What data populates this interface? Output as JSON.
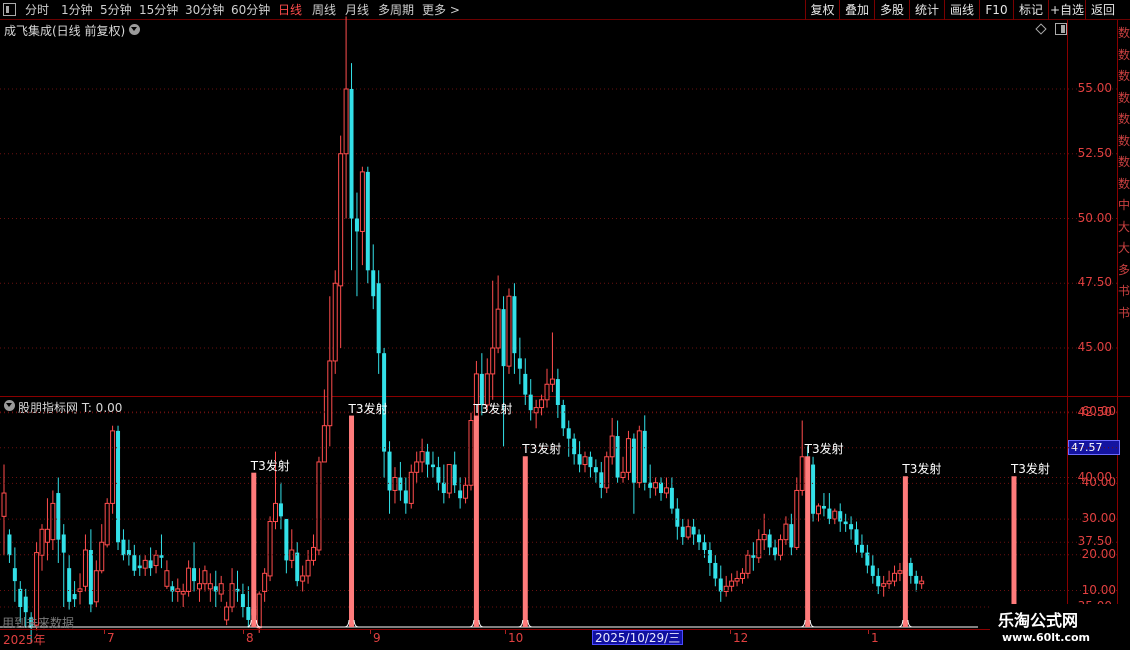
{
  "toolbar": {
    "periods": [
      "分时",
      "1分钟",
      "5分钟",
      "15分钟",
      "30分钟",
      "60分钟",
      "日线",
      "周线",
      "月线",
      "多周期",
      "更多 >"
    ],
    "active_period": "日线",
    "tools": [
      "复权",
      "叠加",
      "多股",
      "统计",
      "画线",
      "F10",
      "标记",
      "+自选",
      "返回"
    ]
  },
  "main_panel": {
    "title": "成飞集成(日线 前复权)",
    "price_ticks": [
      "55.00",
      "52.50",
      "50.00",
      "47.50",
      "45.00",
      "42.50",
      "40.00",
      "37.50",
      "35.00"
    ]
  },
  "indicator_panel": {
    "title": "股朋指标网  T: 0.00",
    "ticks": [
      "60.00",
      "50.00",
      "40.00",
      "30.00",
      "20.00",
      "10.00"
    ],
    "highlight_value": "47.57",
    "signal_text": "T3发射",
    "future_note": "用到未来数据"
  },
  "date_axis": {
    "labels": [
      "2025年",
      "7",
      "8",
      "9",
      "10",
      "11",
      "12",
      "1"
    ],
    "cursor": "2025/10/29/三"
  },
  "right_strip_chars": [
    "数",
    "数",
    "数",
    "数",
    "数",
    "数",
    "数",
    "数",
    "中",
    "大",
    "大",
    "多",
    "书",
    "书"
  ],
  "watermark": {
    "title": "乐淘公式网",
    "url": "www.60lt.com"
  },
  "colors": {
    "up": "#ff4d4d",
    "down": "#33e0e8",
    "signal": "#ff7b7b",
    "axis": "#e04040"
  },
  "chart_data": {
    "type": "candlestick",
    "ylim": [
      33,
      58
    ],
    "candles": [
      [
        38.5,
        40.5,
        39.4,
        37.0
      ],
      [
        37.8,
        38.0,
        37.0,
        36.7
      ],
      [
        36.5,
        37.3,
        36.0,
        35.2
      ],
      [
        35.7,
        36.0,
        35.0,
        34.4
      ],
      [
        35.4,
        35.7,
        34.8,
        34.2
      ],
      [
        34.6,
        34.8,
        34.2,
        33.6
      ],
      [
        34.3,
        37.5,
        37.1,
        34.1
      ],
      [
        37.0,
        38.2,
        38.0,
        36.4
      ],
      [
        37.5,
        39.2,
        38.0,
        36.8
      ],
      [
        37.6,
        39.5,
        39.0,
        37.2
      ],
      [
        39.4,
        40.0,
        37.6,
        36.7
      ],
      [
        37.8,
        38.2,
        37.1,
        35.0
      ],
      [
        36.5,
        37.0,
        35.2,
        34.9
      ],
      [
        35.5,
        36.0,
        35.3,
        35.0
      ],
      [
        35.6,
        36.3,
        35.7,
        35.1
      ],
      [
        35.8,
        37.8,
        37.2,
        35.6
      ],
      [
        37.2,
        38.0,
        35.1,
        34.8
      ],
      [
        35.2,
        36.8,
        36.4,
        35.0
      ],
      [
        36.4,
        38.2,
        37.5,
        36.3
      ],
      [
        37.4,
        39.2,
        39.0,
        37.3
      ],
      [
        39.0,
        42.0,
        41.8,
        38.6
      ],
      [
        41.8,
        42.0,
        37.5,
        37.2
      ],
      [
        37.6,
        38.0,
        37.0,
        36.8
      ],
      [
        37.2,
        37.6,
        37.0,
        36.6
      ],
      [
        37.0,
        37.4,
        36.4,
        36.2
      ],
      [
        36.6,
        37.0,
        36.5,
        36.2
      ],
      [
        36.5,
        37.0,
        36.8,
        36.2
      ],
      [
        36.8,
        37.3,
        36.5,
        36.2
      ],
      [
        36.6,
        37.2,
        37.0,
        36.3
      ],
      [
        37.0,
        37.8,
        36.9,
        36.5
      ],
      [
        35.8,
        36.8,
        36.4,
        35.7
      ],
      [
        35.8,
        36.0,
        35.6,
        35.2
      ],
      [
        35.6,
        36.1,
        35.7,
        35.2
      ],
      [
        35.5,
        35.9,
        35.6,
        35.0
      ],
      [
        35.6,
        36.8,
        36.5,
        35.4
      ],
      [
        36.5,
        37.5,
        36.0,
        35.6
      ],
      [
        35.7,
        36.5,
        35.9,
        35.2
      ],
      [
        35.9,
        36.6,
        36.4,
        35.6
      ],
      [
        35.7,
        36.3,
        35.9,
        35.2
      ],
      [
        35.8,
        36.4,
        35.6,
        35.0
      ],
      [
        35.5,
        36.2,
        35.9,
        35.2
      ],
      [
        34.5,
        35.2,
        35.0,
        34.3
      ],
      [
        35.0,
        36.5,
        35.9,
        34.8
      ],
      [
        35.7,
        36.4,
        35.6,
        35.2
      ],
      [
        35.5,
        35.9,
        35.0,
        34.6
      ],
      [
        35.0,
        35.8,
        34.5,
        34.2
      ],
      [
        34.7,
        35.4,
        34.9,
        34.3
      ],
      [
        34.2,
        35.6,
        35.5,
        34.0
      ],
      [
        35.6,
        36.5,
        36.3,
        35.2
      ],
      [
        36.2,
        38.5,
        38.3,
        36.0
      ],
      [
        38.3,
        41.0,
        39.0,
        38.0
      ],
      [
        39.0,
        39.8,
        38.5,
        38.0
      ],
      [
        38.4,
        37.6,
        36.8,
        36.3
      ],
      [
        36.8,
        38.0,
        37.2,
        36.5
      ],
      [
        37.1,
        37.5,
        36.0,
        35.8
      ],
      [
        36.0,
        36.6,
        36.2,
        35.6
      ],
      [
        36.2,
        37.2,
        36.8,
        35.9
      ],
      [
        36.8,
        37.8,
        37.3,
        36.6
      ],
      [
        37.2,
        40.8,
        40.6,
        37.0
      ],
      [
        40.6,
        43.4,
        42.0,
        41.5
      ],
      [
        42.0,
        47.0,
        44.5,
        41.2
      ],
      [
        44.5,
        48.0,
        47.5,
        44.0
      ],
      [
        47.4,
        53.2,
        52.5,
        45.0
      ],
      [
        52.5,
        57.8,
        55.0,
        50.0
      ],
      [
        55.0,
        56.0,
        50.0,
        48.0
      ],
      [
        50.0,
        51.0,
        49.5,
        47.0
      ],
      [
        49.5,
        52.0,
        51.8,
        48.2
      ],
      [
        51.8,
        52.0,
        48.0,
        47.5
      ],
      [
        48.0,
        49.0,
        47.0,
        46.5
      ],
      [
        47.5,
        48.0,
        44.8,
        44.0
      ],
      [
        44.8,
        45.0,
        41.0,
        40.0
      ],
      [
        41.0,
        41.4,
        39.5,
        38.6
      ],
      [
        39.5,
        40.4,
        40.0,
        39.0
      ],
      [
        40.0,
        40.6,
        39.5,
        39.1
      ],
      [
        39.5,
        40.0,
        39.0,
        38.6
      ],
      [
        39.0,
        40.5,
        40.2,
        38.8
      ],
      [
        40.2,
        41.0,
        40.6,
        39.8
      ],
      [
        40.6,
        41.5,
        41.0,
        40.2
      ],
      [
        41.0,
        41.3,
        40.5,
        40.0
      ],
      [
        40.5,
        41.0,
        40.4,
        40.0
      ],
      [
        40.4,
        40.8,
        39.8,
        39.5
      ],
      [
        39.8,
        40.5,
        39.4,
        39.0
      ],
      [
        39.4,
        40.0,
        40.5,
        39.2
      ],
      [
        40.5,
        41.0,
        39.7,
        39.4
      ],
      [
        39.5,
        40.0,
        39.2,
        38.8
      ],
      [
        39.2,
        40.0,
        39.7,
        39.0
      ],
      [
        39.7,
        42.5,
        42.2,
        39.5
      ],
      [
        42.2,
        44.5,
        44.0,
        41.8
      ],
      [
        44.0,
        44.8,
        42.8,
        42.4
      ],
      [
        42.8,
        44.6,
        44.0,
        42.6
      ],
      [
        44.0,
        47.6,
        45.0,
        43.0
      ],
      [
        45.0,
        47.8,
        46.5,
        44.8
      ],
      [
        46.5,
        47.0,
        44.3,
        41.2
      ],
      [
        44.3,
        47.3,
        47.0,
        44.0
      ],
      [
        47.0,
        47.5,
        44.8,
        44.0
      ],
      [
        44.6,
        45.4,
        44.2,
        43.6
      ],
      [
        44.0,
        44.6,
        43.2,
        42.8
      ],
      [
        43.2,
        43.8,
        42.6,
        42.2
      ],
      [
        42.5,
        43.0,
        42.7,
        41.9
      ],
      [
        42.7,
        43.2,
        43.0,
        42.4
      ],
      [
        43.0,
        44.2,
        43.6,
        42.7
      ],
      [
        43.6,
        45.6,
        43.8,
        43.3
      ],
      [
        43.8,
        44.2,
        42.8,
        42.3
      ],
      [
        42.8,
        43.0,
        41.9,
        41.6
      ],
      [
        41.9,
        42.2,
        41.5,
        40.8
      ],
      [
        41.5,
        41.7,
        40.9,
        40.5
      ],
      [
        40.9,
        41.4,
        40.5,
        40.2
      ],
      [
        40.5,
        41.0,
        40.8,
        40.2
      ],
      [
        40.8,
        41.0,
        40.4,
        40.0
      ],
      [
        40.4,
        40.7,
        40.2,
        39.8
      ],
      [
        40.2,
        40.6,
        39.6,
        39.2
      ],
      [
        39.6,
        41.0,
        40.8,
        39.4
      ],
      [
        40.8,
        42.3,
        41.6,
        40.5
      ],
      [
        41.6,
        42.2,
        40.0,
        39.8
      ],
      [
        40.0,
        40.8,
        40.2,
        39.8
      ],
      [
        40.2,
        41.8,
        41.5,
        39.9
      ],
      [
        41.5,
        41.7,
        39.8,
        38.6
      ],
      [
        39.8,
        42.0,
        41.8,
        39.6
      ],
      [
        41.8,
        42.4,
        39.8,
        39.5
      ],
      [
        39.8,
        40.5,
        39.6,
        39.2
      ],
      [
        39.6,
        40.0,
        39.8,
        39.3
      ],
      [
        39.8,
        40.0,
        39.4,
        39.1
      ],
      [
        39.4,
        40.0,
        39.6,
        39.2
      ],
      [
        39.6,
        40.0,
        38.8,
        38.6
      ],
      [
        38.8,
        39.2,
        38.1,
        37.6
      ],
      [
        38.1,
        38.4,
        37.7,
        37.4
      ],
      [
        37.7,
        38.4,
        38.1,
        37.6
      ],
      [
        38.1,
        38.4,
        37.8,
        37.4
      ],
      [
        37.8,
        38.0,
        37.5,
        37.2
      ],
      [
        37.5,
        37.8,
        37.2,
        36.9
      ],
      [
        37.2,
        37.5,
        36.7,
        36.2
      ],
      [
        36.7,
        37.0,
        36.1,
        35.8
      ],
      [
        36.1,
        36.6,
        35.6,
        35.2
      ],
      [
        35.6,
        36.2,
        35.8,
        35.4
      ],
      [
        35.8,
        36.3,
        36.0,
        35.6
      ],
      [
        36.0,
        36.4,
        36.1,
        35.8
      ],
      [
        36.1,
        36.5,
        36.3,
        35.9
      ],
      [
        36.3,
        37.2,
        37.0,
        36.1
      ],
      [
        37.0,
        37.5,
        36.9,
        36.4
      ],
      [
        36.9,
        38.0,
        37.6,
        36.7
      ],
      [
        37.6,
        38.6,
        37.8,
        37.2
      ],
      [
        37.8,
        38.0,
        37.3,
        37.0
      ],
      [
        37.3,
        37.6,
        37.0,
        36.8
      ],
      [
        37.0,
        37.8,
        37.6,
        36.8
      ],
      [
        37.6,
        38.5,
        38.2,
        37.4
      ],
      [
        38.2,
        38.6,
        37.3,
        37.0
      ],
      [
        37.3,
        40.0,
        39.5,
        37.2
      ],
      [
        39.5,
        42.2,
        40.8,
        39.3
      ],
      [
        40.8,
        41.2,
        40.5,
        39.8
      ],
      [
        40.5,
        40.8,
        38.6,
        38.3
      ],
      [
        38.6,
        39.0,
        38.9,
        38.3
      ],
      [
        38.9,
        39.4,
        38.8,
        38.5
      ],
      [
        38.8,
        39.4,
        38.4,
        38.2
      ],
      [
        38.4,
        38.8,
        38.7,
        38.2
      ],
      [
        38.7,
        39.0,
        38.3,
        37.9
      ],
      [
        38.3,
        38.6,
        38.2,
        37.9
      ],
      [
        38.2,
        38.5,
        38.0,
        37.6
      ],
      [
        38.0,
        38.3,
        37.4,
        37.1
      ],
      [
        37.4,
        37.8,
        37.1,
        36.9
      ],
      [
        37.1,
        37.4,
        36.6,
        36.3
      ],
      [
        36.6,
        37.0,
        36.2,
        35.9
      ],
      [
        36.2,
        36.5,
        35.8,
        35.5
      ],
      [
        35.8,
        36.2,
        35.9,
        35.4
      ],
      [
        35.9,
        36.4,
        36.0,
        35.7
      ],
      [
        36.0,
        36.6,
        36.3,
        35.8
      ],
      [
        36.3,
        36.7,
        36.4,
        36.0
      ],
      [
        36.4,
        36.8,
        36.7,
        36.1
      ],
      [
        36.7,
        36.9,
        36.2,
        35.9
      ],
      [
        36.2,
        36.4,
        35.9,
        35.6
      ],
      [
        35.9,
        36.2,
        36.0,
        35.7
      ]
    ],
    "indicator": {
      "name": "T3发射",
      "ylim": [
        0,
        62
      ],
      "signals": [
        {
          "index": 46,
          "value": 43
        },
        {
          "index": 64,
          "value": 59
        },
        {
          "index": 87,
          "value": 59
        },
        {
          "index": 96,
          "value": 47.6
        },
        {
          "index": 148,
          "value": 47.6
        },
        {
          "index": 166,
          "value": 42
        },
        {
          "index": 186,
          "value": 42
        }
      ]
    }
  }
}
